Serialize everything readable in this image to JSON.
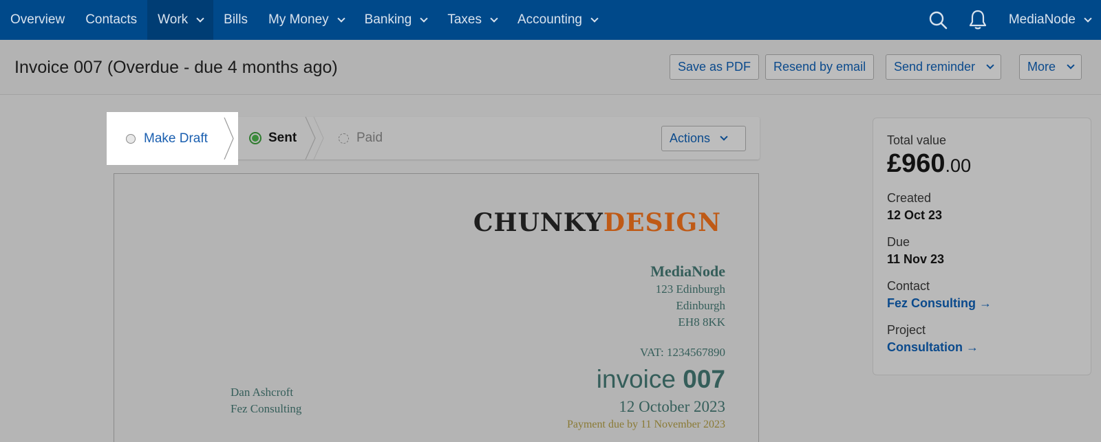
{
  "nav": {
    "items": [
      {
        "label": "Overview",
        "dropdown": false,
        "active": false
      },
      {
        "label": "Contacts",
        "dropdown": false,
        "active": false
      },
      {
        "label": "Work",
        "dropdown": true,
        "active": true
      },
      {
        "label": "Bills",
        "dropdown": false,
        "active": false
      },
      {
        "label": "My Money",
        "dropdown": true,
        "active": false
      },
      {
        "label": "Banking",
        "dropdown": true,
        "active": false
      },
      {
        "label": "Taxes",
        "dropdown": true,
        "active": false
      },
      {
        "label": "Accounting",
        "dropdown": true,
        "active": false
      }
    ],
    "user_label": "MediaNode",
    "colors": {
      "bar": "#00498a",
      "active": "#003d74"
    }
  },
  "header": {
    "title": "Invoice 007 (Overdue - due 4 months ago)",
    "buttons": {
      "save_pdf": "Save as PDF",
      "resend": "Resend by email",
      "reminder": "Send reminder",
      "more": "More"
    }
  },
  "status": {
    "draft_label": "Make Draft",
    "sent_label": "Sent",
    "paid_label": "Paid",
    "actions_label": "Actions"
  },
  "invoice": {
    "logo_part1": "CHUNKY",
    "logo_part2": "DESIGN",
    "sender_name": "MediaNode",
    "sender_lines": [
      "123 Edinburgh",
      "Edinburgh",
      "EH8 8KK"
    ],
    "vat": "VAT: 1234567890",
    "invoice_word": "invoice",
    "invoice_number": "007",
    "date": "12 October 2023",
    "due": "Payment due by 11 November 2023",
    "recipient_lines": [
      "Dan Ashcroft",
      "Fez Consulting"
    ]
  },
  "summary": {
    "total_label": "Total value",
    "total_main": "£960",
    "total_cents": ".00",
    "created_label": "Created",
    "created_value": "12 Oct 23",
    "due_label": "Due",
    "due_value": "11 Nov 23",
    "contact_label": "Contact",
    "contact_value": "Fez Consulting →",
    "project_label": "Project",
    "project_value": "Consultation →"
  }
}
